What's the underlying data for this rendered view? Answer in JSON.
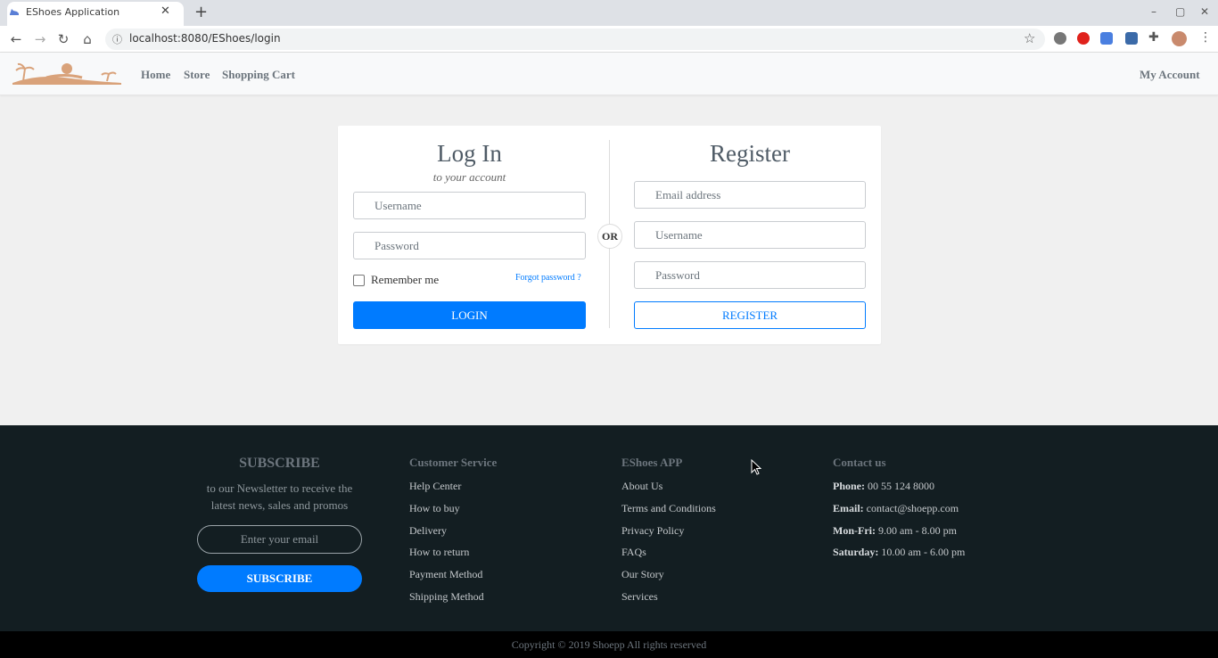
{
  "browser": {
    "tab_title": "EShoes Application",
    "new_tab": "+",
    "url": "localhost:8080/EShoes/login",
    "win_min": "–",
    "win_max": "▢",
    "win_close": "✕",
    "tab_close": "✕"
  },
  "header": {
    "nav": [
      "Home",
      "Store",
      "Shopping Cart"
    ],
    "account": "My Account"
  },
  "login": {
    "title": "Log In",
    "subtitle": "to your account",
    "username_placeholder": "Username",
    "password_placeholder": "Password",
    "remember": "Remember me",
    "forgot": "Forgot password ?",
    "button": "Login"
  },
  "or_label": "OR",
  "register": {
    "title": "Register",
    "email_placeholder": "Email address",
    "username_placeholder": "Username",
    "password_placeholder": "Password",
    "button": "REGISTER"
  },
  "footer": {
    "subscribe": {
      "title": "SUBSCRIBE",
      "text_line1": "to our Newsletter to receive the",
      "text_line2": "latest news, sales and promos",
      "email_placeholder": "Enter your email",
      "button": "SUBSCRIBE"
    },
    "customer_service": {
      "title": "Customer Service",
      "links": [
        "Help Center",
        "How to buy",
        "Delivery",
        "How to return",
        "Payment Method",
        "Shipping Method"
      ]
    },
    "app": {
      "title": "EShoes APP",
      "links": [
        "About Us",
        "Terms and Conditions",
        "Privacy Policy",
        "FAQs",
        "Our Story",
        "Services"
      ]
    },
    "contact": {
      "title": "Contact us",
      "rows": [
        {
          "label": "Phone:",
          "value": "00 55 124 8000"
        },
        {
          "label": "Email:",
          "value": "contact@shoepp.com"
        },
        {
          "label": "Mon-Fri:",
          "value": "9.00 am - 8.00 pm"
        },
        {
          "label": "Saturday:",
          "value": "10.00 am - 6.00 pm"
        }
      ]
    },
    "copyright": "Copyright © 2019 Shoepp All rights reserved"
  },
  "colors": {
    "primary": "#007bff",
    "footer_bg": "#131e22",
    "logo": "#d9a27a"
  }
}
